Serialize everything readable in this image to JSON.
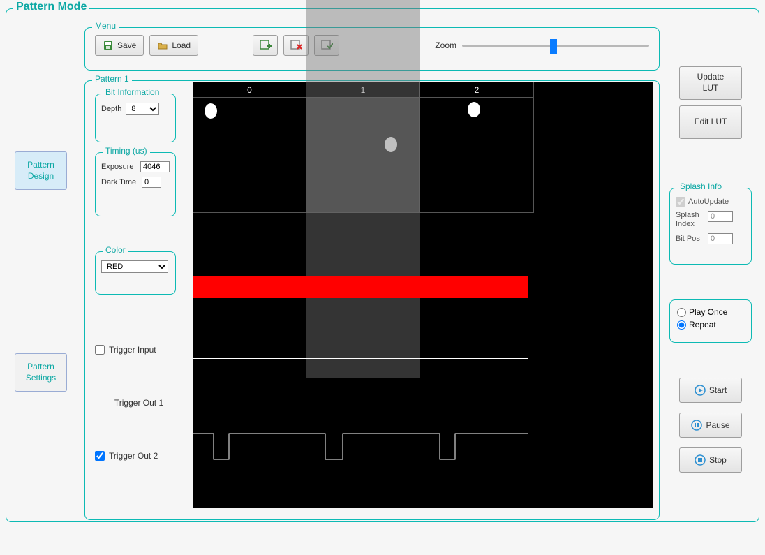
{
  "window": {
    "title": "Pattern Mode"
  },
  "tabs": {
    "design": "Pattern\nDesign",
    "settings": "Pattern\nSettings"
  },
  "menu": {
    "legend": "Menu",
    "save": "Save",
    "load": "Load",
    "zoom": "Zoom"
  },
  "pattern_group": {
    "legend": "Pattern 1"
  },
  "bitinfo": {
    "legend": "Bit Information",
    "depth_label": "Depth",
    "depth_value": "8"
  },
  "timing": {
    "legend": "Timing (us)",
    "exposure_label": "Exposure",
    "exposure": "4046",
    "dark_label": "Dark Time",
    "dark": "0"
  },
  "color": {
    "legend": "Color",
    "value": "RED"
  },
  "triggers": {
    "input": "Trigger Input",
    "out1": "Trigger Out 1",
    "out2": "Trigger Out 2"
  },
  "cols": [
    "0",
    "1",
    "2"
  ],
  "lut": {
    "update": "Update\nLUT",
    "edit": "Edit LUT"
  },
  "splash": {
    "legend": "Splash Info",
    "auto": "AutoUpdate",
    "index_label": "Splash Index",
    "index": "0",
    "bitpos_label": "Bit Pos",
    "bitpos": "0"
  },
  "play": {
    "once": "Play Once",
    "repeat": "Repeat"
  },
  "controls": {
    "start": "Start",
    "pause": "Pause",
    "stop": "Stop"
  }
}
